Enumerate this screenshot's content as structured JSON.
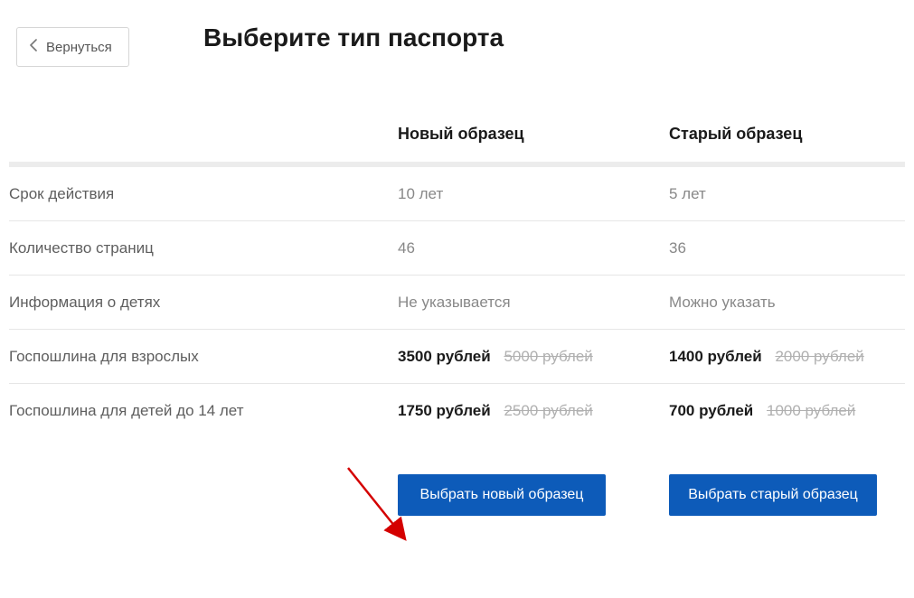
{
  "back_label": "Вернуться",
  "title": "Выберите тип паспорта",
  "columns": {
    "new": "Новый образец",
    "old": "Старый образец"
  },
  "rows": {
    "validity": {
      "label": "Срок действия",
      "new": "10 лет",
      "old": "5 лет"
    },
    "pages": {
      "label": "Количество страниц",
      "new": "46",
      "old": "36"
    },
    "children": {
      "label": "Информация о детях",
      "new": "Не указывается",
      "old": "Можно указать"
    },
    "fee_adult": {
      "label": "Госпошлина для взрослых",
      "new_price": "3500 рублей",
      "new_strike": "5000 рублей",
      "old_price": "1400 рублей",
      "old_strike": "2000 рублей"
    },
    "fee_child": {
      "label": "Госпошлина для детей до 14 лет",
      "new_price": "1750 рублей",
      "new_strike": "2500 рублей",
      "old_price": "700 рублей",
      "old_strike": "1000 рублей"
    }
  },
  "buttons": {
    "select_new": "Выбрать новый образец",
    "select_old": "Выбрать старый образец"
  }
}
